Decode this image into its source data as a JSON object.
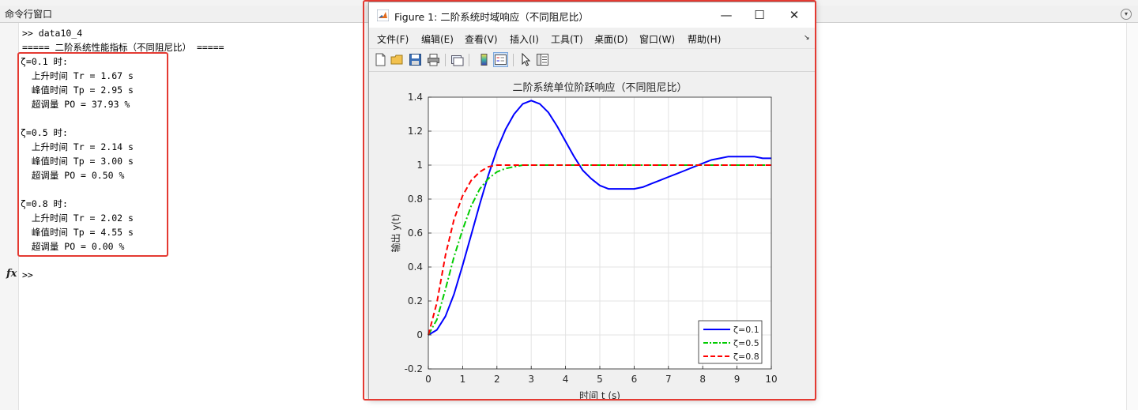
{
  "command_window": {
    "title": "命令行窗口",
    "prompt_line": ">> data10_4",
    "header_line": "===== 二阶系统性能指标（不同阻尼比） =====",
    "results": [
      {
        "heading": "ζ=0.1 时:",
        "tr": "  上升时间 Tr = 1.67 s",
        "tp": "  峰值时间 Tp = 2.95 s",
        "po": "  超调量 PO = 37.93 %"
      },
      {
        "heading": "ζ=0.5 时:",
        "tr": "  上升时间 Tr = 2.14 s",
        "tp": "  峰值时间 Tp = 3.00 s",
        "po": "  超调量 PO = 0.50 %"
      },
      {
        "heading": "ζ=0.8 时:",
        "tr": "  上升时间 Tr = 2.02 s",
        "tp": "  峰值时间 Tp = 4.55 s",
        "po": "  超调量 PO = 0.00 %"
      }
    ],
    "fx_symbol": "fx",
    "prompt": ">>",
    "annotation_color": "#e43a32"
  },
  "figure": {
    "title": "Figure 1: 二阶系统时域响应（不同阻尼比）",
    "window_buttons": {
      "minimize": "—",
      "maximize": "☐",
      "close": "✕"
    },
    "menus": [
      "文件(F)",
      "编辑(E)",
      "查看(V)",
      "插入(I)",
      "工具(T)",
      "桌面(D)",
      "窗口(W)",
      "帮助(H)"
    ],
    "toolbar_icons": [
      "new-figure-icon",
      "open-icon",
      "save-icon",
      "print-icon",
      "link-plot-icon",
      "colorbar-icon",
      "legend-icon",
      "pointer-icon",
      "property-inspector-icon"
    ]
  },
  "chart_data": {
    "type": "line",
    "title": "二阶系统单位阶跃响应（不同阻尼比）",
    "xlabel": "时间 t (s)",
    "ylabel": "输出 y(t)",
    "xlim": [
      0,
      10
    ],
    "ylim": [
      -0.2,
      1.4
    ],
    "xticks": [
      "0",
      "1",
      "2",
      "3",
      "4",
      "5",
      "6",
      "7",
      "8",
      "9",
      "10"
    ],
    "yticks": [
      "-0.2",
      "0",
      "0.2",
      "0.4",
      "0.6",
      "0.8",
      "1",
      "1.2",
      "1.4"
    ],
    "grid": true,
    "legend_position": "bottom-right",
    "series": [
      {
        "name": "ζ=0.1",
        "color": "#0000ff",
        "style": "solid",
        "x": [
          0,
          0.25,
          0.5,
          0.75,
          1,
          1.25,
          1.5,
          1.75,
          2,
          2.25,
          2.5,
          2.75,
          3,
          3.25,
          3.5,
          3.75,
          4,
          4.25,
          4.5,
          4.75,
          5,
          5.25,
          5.5,
          5.75,
          6,
          6.25,
          6.5,
          6.75,
          7,
          7.25,
          7.5,
          7.75,
          8,
          8.25,
          8.5,
          8.75,
          9,
          9.25,
          9.5,
          9.75,
          10
        ],
        "y": [
          0,
          0.03,
          0.11,
          0.24,
          0.41,
          0.59,
          0.77,
          0.94,
          1.09,
          1.21,
          1.3,
          1.36,
          1.38,
          1.36,
          1.31,
          1.23,
          1.14,
          1.05,
          0.97,
          0.92,
          0.88,
          0.86,
          0.86,
          0.86,
          0.86,
          0.87,
          0.89,
          0.91,
          0.93,
          0.95,
          0.97,
          0.99,
          1.01,
          1.03,
          1.04,
          1.05,
          1.05,
          1.05,
          1.05,
          1.04,
          1.04
        ]
      },
      {
        "name": "ζ=0.5",
        "color": "#00cc00",
        "style": "dashdot",
        "x": [
          0,
          0.25,
          0.5,
          0.75,
          1,
          1.25,
          1.5,
          1.75,
          2,
          2.25,
          2.5,
          2.75,
          3,
          3.5,
          4,
          5,
          6,
          7,
          8,
          9,
          10
        ],
        "y": [
          0,
          0.09,
          0.27,
          0.46,
          0.62,
          0.76,
          0.86,
          0.92,
          0.96,
          0.98,
          0.99,
          1.0,
          1.0,
          1.0,
          1.0,
          1.0,
          1.0,
          1.0,
          1.0,
          1.0,
          1.0
        ]
      },
      {
        "name": "ζ=0.8",
        "color": "#ff0000",
        "style": "dashed",
        "x": [
          0,
          0.25,
          0.5,
          0.75,
          1,
          1.25,
          1.5,
          1.75,
          2,
          2.5,
          3,
          3.5,
          4,
          5,
          6,
          7,
          8,
          9,
          10
        ],
        "y": [
          0,
          0.19,
          0.47,
          0.68,
          0.82,
          0.91,
          0.96,
          0.99,
          1.0,
          1.0,
          1.0,
          1.0,
          1.0,
          1.0,
          1.0,
          1.0,
          1.0,
          1.0,
          1.0
        ]
      }
    ]
  }
}
